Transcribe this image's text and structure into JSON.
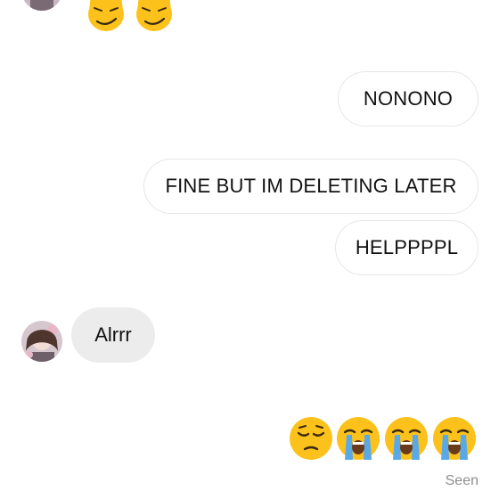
{
  "conversation": {
    "top_reaction_emojis": [
      "cat-smirk",
      "cat-smirk"
    ],
    "messages": [
      {
        "side": "outgoing",
        "text": "NONONO"
      },
      {
        "side": "outgoing",
        "text": "FINE BUT IM DELETING LATER"
      },
      {
        "side": "outgoing",
        "text": "HELPPPPL"
      },
      {
        "side": "incoming",
        "text": "Alrrr"
      }
    ],
    "bottom_emojis": [
      "pensive-face",
      "loudly-crying-face",
      "loudly-crying-face",
      "loudly-crying-face"
    ],
    "status": "Seen"
  },
  "colors": {
    "incoming_bubble": "#ececec",
    "outgoing_border": "#e6e6e6",
    "seen_text": "#8e8e8e",
    "emoji_yellow": "#fcc21b"
  }
}
